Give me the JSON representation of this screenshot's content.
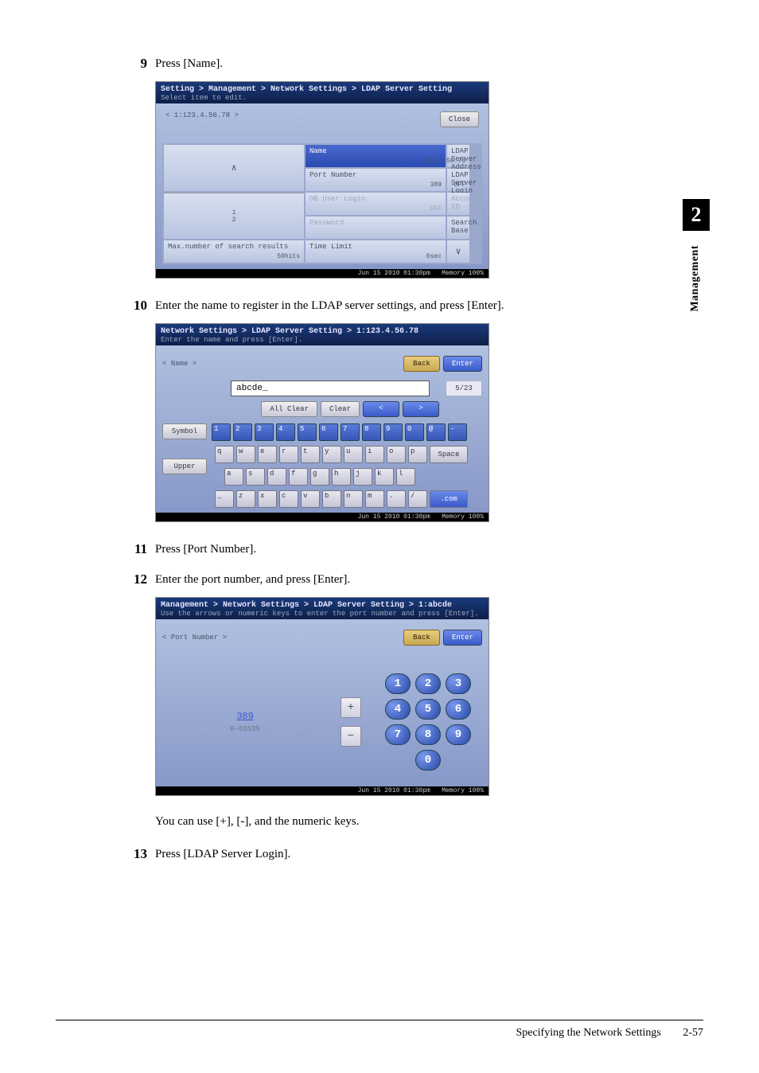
{
  "side": {
    "chapter_num": "2",
    "chapter_label": "Management"
  },
  "steps": {
    "s9": {
      "num": "9",
      "text": "Press [Name]."
    },
    "s10": {
      "num": "10",
      "text": "Enter the name to register in the LDAP server settings, and press [Enter]."
    },
    "s11": {
      "num": "11",
      "text": "Press [Port Number]."
    },
    "s12": {
      "num": "12",
      "text": "Enter the port number, and press [Enter]."
    },
    "s12_note": "You can use [+], [-], and the numeric keys.",
    "s13": {
      "num": "13",
      "text": "Press [LDAP Server Login]."
    }
  },
  "screen1": {
    "breadcrumb": "Setting > Management > Network Settings > LDAP Server Setting",
    "subtitle": "Select item to edit.",
    "top_label": "< 1:123.4.56.78 >",
    "close": "Close",
    "cells": {
      "name": {
        "label": "Name",
        "value": ""
      },
      "addr": {
        "label": "LDAP Server Address",
        "value": "123.4.56.78"
      },
      "port": {
        "label": "Port Number",
        "value": "389"
      },
      "login": {
        "label": "LDAP Server Login",
        "value": "OFF"
      },
      "ob": {
        "label": "OB User Login",
        "value": "OFF"
      },
      "acct": {
        "label": "Account ID",
        "value": ""
      },
      "pw": {
        "label": "Password",
        "value": ""
      },
      "search": {
        "label": "Search Base",
        "value": ""
      },
      "max": {
        "label": "Max.number of search results",
        "value": "50hits"
      },
      "time": {
        "label": "Time Limit",
        "value": "0sec"
      }
    },
    "page_tab_1": "1",
    "page_tab_2": "2",
    "arrow_up": "∧",
    "arrow_down": "∨",
    "status_time": "Jun 15 2010 01:30pm",
    "status_mem": "Memory  100%"
  },
  "screen2": {
    "breadcrumb": "Network Settings > LDAP Server Setting > 1:123.4.56.78",
    "subtitle": "Enter the name and press [Enter].",
    "top_label": "< Name >",
    "back": "Back",
    "enter": "Enter",
    "input_value": "abcde_",
    "counter": "5/23",
    "all_clear": "All Clear",
    "clear": "Clear",
    "nav_l": "<",
    "nav_r": ">",
    "symbol_btn": "Symbol",
    "upper_btn": "Upper",
    "space": "Space",
    "com": ".com",
    "rows": {
      "r1": [
        "1",
        "2",
        "3",
        "4",
        "5",
        "6",
        "7",
        "8",
        "9",
        "0",
        "@",
        "-"
      ],
      "r2": [
        "q",
        "w",
        "e",
        "r",
        "t",
        "y",
        "u",
        "i",
        "o",
        "p"
      ],
      "r3": [
        "a",
        "s",
        "d",
        "f",
        "g",
        "h",
        "j",
        "k",
        "l"
      ],
      "r4": [
        "_",
        "z",
        "x",
        "c",
        "v",
        "b",
        "n",
        "m",
        ".",
        "/"
      ]
    },
    "status_time": "Jun 15 2010 01:30pm",
    "status_mem": "Memory  100%"
  },
  "screen3": {
    "breadcrumb": "Management > Network Settings > LDAP Server Setting > 1:abcde",
    "subtitle": "Use the arrows or numeric keys to enter the port number and press [Enter].",
    "top_label": "< Port Number >",
    "back": "Back",
    "enter": "Enter",
    "value": "389",
    "range": "0-65535",
    "plus": "+",
    "minus": "−",
    "keys": [
      "1",
      "2",
      "3",
      "4",
      "5",
      "6",
      "7",
      "8",
      "9",
      "0"
    ],
    "status_time": "Jun 15 2010 01:30pm",
    "status_mem": "Memory  100%"
  },
  "footer": {
    "title": "Specifying the Network Settings",
    "page": "2-57"
  }
}
